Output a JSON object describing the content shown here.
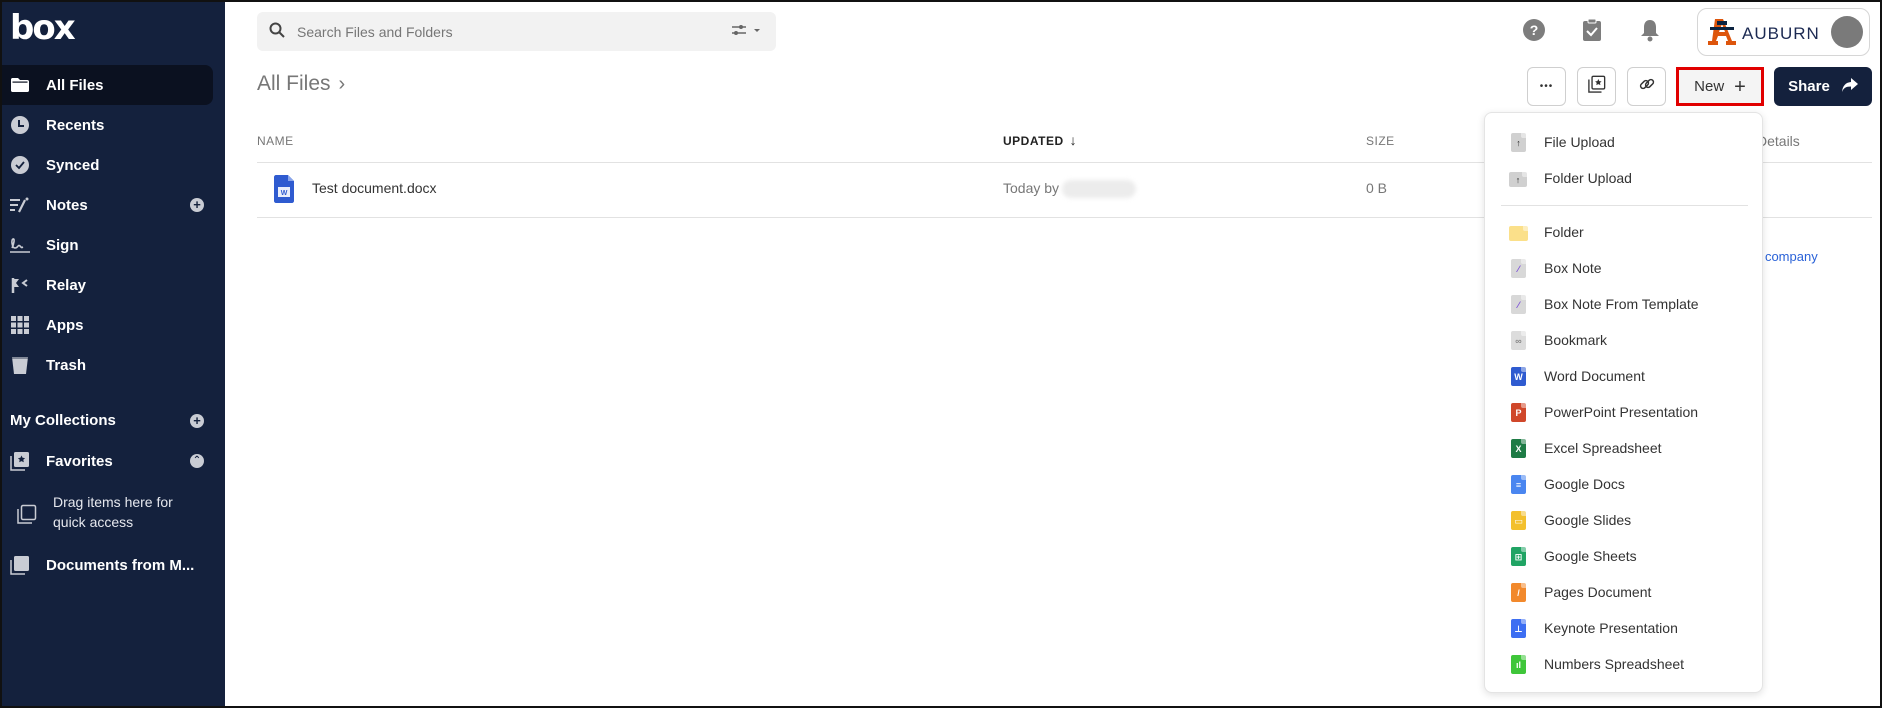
{
  "app": {
    "logo_text": "box"
  },
  "sidebar": {
    "items": [
      {
        "label": "All Files",
        "icon": "folder-icon",
        "active": true
      },
      {
        "label": "Recents",
        "icon": "clock-icon"
      },
      {
        "label": "Synced",
        "icon": "check-circle-icon"
      },
      {
        "label": "Notes",
        "icon": "notes-icon",
        "has_add": true
      },
      {
        "label": "Sign",
        "icon": "signature-icon"
      },
      {
        "label": "Relay",
        "icon": "relay-icon"
      },
      {
        "label": "Apps",
        "icon": "apps-grid-icon"
      },
      {
        "label": "Trash",
        "icon": "trash-icon"
      }
    ],
    "collections_title": "My Collections",
    "favorites_label": "Favorites",
    "favorites_hint": "Drag items here for quick access",
    "collection_item": "Documents from M..."
  },
  "search": {
    "placeholder": "Search Files and Folders",
    "value": ""
  },
  "account": {
    "org_name": "AUBURN",
    "org_logo": "AU"
  },
  "breadcrumb": {
    "current": "All Files",
    "chevron": "›"
  },
  "toolbar": {
    "more_label": "•••",
    "new_label": "New",
    "new_icon": "+",
    "share_label": "Share"
  },
  "table": {
    "columns": {
      "name": "NAME",
      "updated": "UPDATED",
      "size": "SIZE"
    },
    "sort_indicator": "↓",
    "rows": [
      {
        "name": "Test document.docx",
        "updated": "Today by",
        "size": "0 B",
        "icon": "word-file-icon"
      }
    ]
  },
  "sidepanel_peek": {
    "details": "Details",
    "company": "r company"
  },
  "new_menu": {
    "upload_items": [
      {
        "label": "File Upload",
        "icon": "file-upload-icon",
        "color": "#cfcfcf"
      },
      {
        "label": "Folder Upload",
        "icon": "folder-upload-icon",
        "color": "#cfcfcf"
      }
    ],
    "create_items": [
      {
        "label": "Folder",
        "icon": "folder-icon",
        "color": "#fbe08a"
      },
      {
        "label": "Box Note",
        "icon": "box-note-icon",
        "color": "#d8d8d8"
      },
      {
        "label": "Box Note From Template",
        "icon": "box-note-template-icon",
        "color": "#d8d8d8"
      },
      {
        "label": "Bookmark",
        "icon": "bookmark-icon",
        "color": "#dcdcdc"
      },
      {
        "label": "Word Document",
        "icon": "word-icon",
        "color": "#2f5bd0"
      },
      {
        "label": "PowerPoint Presentation",
        "icon": "powerpoint-icon",
        "color": "#d0472a"
      },
      {
        "label": "Excel Spreadsheet",
        "icon": "excel-icon",
        "color": "#1e7b45"
      },
      {
        "label": "Google Docs",
        "icon": "google-docs-icon",
        "color": "#4a86f0"
      },
      {
        "label": "Google Slides",
        "icon": "google-slides-icon",
        "color": "#f3c02d"
      },
      {
        "label": "Google Sheets",
        "icon": "google-sheets-icon",
        "color": "#20a464"
      },
      {
        "label": "Pages Document",
        "icon": "pages-icon",
        "color": "#f2892c"
      },
      {
        "label": "Keynote Presentation",
        "icon": "keynote-icon",
        "color": "#3d6ef2"
      },
      {
        "label": "Numbers Spreadsheet",
        "icon": "numbers-icon",
        "color": "#3fc63a"
      }
    ]
  },
  "colors": {
    "sidebar_bg": "#14213d",
    "share_bg": "#14213d",
    "highlight": "#e10000",
    "link": "#2a62d8"
  }
}
